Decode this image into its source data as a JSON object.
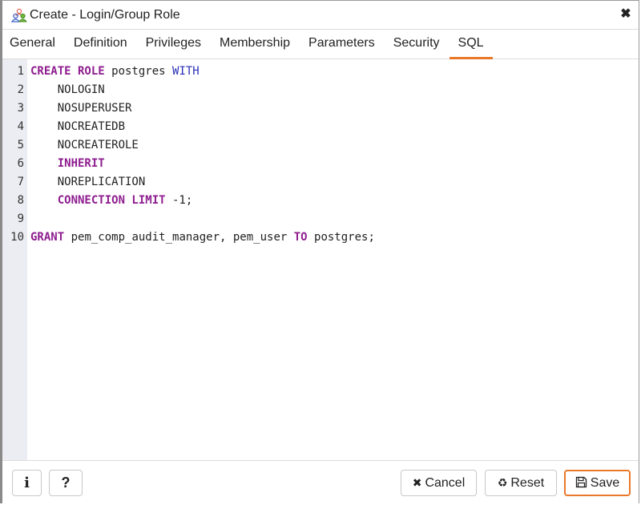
{
  "window": {
    "title": "Create - Login/Group Role",
    "icon": "group-role-icon",
    "close_icon": "✖"
  },
  "tabs": [
    {
      "label": "General",
      "active": false
    },
    {
      "label": "Definition",
      "active": false
    },
    {
      "label": "Privileges",
      "active": false
    },
    {
      "label": "Membership",
      "active": false
    },
    {
      "label": "Parameters",
      "active": false
    },
    {
      "label": "Security",
      "active": false
    },
    {
      "label": "SQL",
      "active": true
    }
  ],
  "editor": {
    "lines": [
      {
        "num": "1",
        "tokens": [
          {
            "t": "CREATE ROLE",
            "c": "kw"
          },
          {
            "t": " postgres ",
            "c": ""
          },
          {
            "t": "WITH",
            "c": "kw2"
          }
        ]
      },
      {
        "num": "2",
        "tokens": [
          {
            "t": "    NOLOGIN",
            "c": ""
          }
        ]
      },
      {
        "num": "3",
        "tokens": [
          {
            "t": "    NOSUPERUSER",
            "c": ""
          }
        ]
      },
      {
        "num": "4",
        "tokens": [
          {
            "t": "    NOCREATEDB",
            "c": ""
          }
        ]
      },
      {
        "num": "5",
        "tokens": [
          {
            "t": "    NOCREATEROLE",
            "c": ""
          }
        ]
      },
      {
        "num": "6",
        "tokens": [
          {
            "t": "    ",
            "c": ""
          },
          {
            "t": "INHERIT",
            "c": "kw"
          }
        ]
      },
      {
        "num": "7",
        "tokens": [
          {
            "t": "    NOREPLICATION",
            "c": ""
          }
        ]
      },
      {
        "num": "8",
        "tokens": [
          {
            "t": "    ",
            "c": ""
          },
          {
            "t": "CONNECTION LIMIT",
            "c": "kw"
          },
          {
            "t": " -1;",
            "c": ""
          }
        ]
      },
      {
        "num": "9",
        "tokens": []
      },
      {
        "num": "10",
        "tokens": [
          {
            "t": "GRANT",
            "c": "kw"
          },
          {
            "t": " pem_comp_audit_manager, pem_user ",
            "c": ""
          },
          {
            "t": "TO",
            "c": "kw"
          },
          {
            "t": " postgres;",
            "c": ""
          }
        ]
      }
    ]
  },
  "footer": {
    "info_label": "i",
    "help_label": "?",
    "cancel_icon": "✖",
    "cancel_label": "Cancel",
    "reset_icon": "♻",
    "reset_label": "Reset",
    "save_icon": "🖫",
    "save_label": "Save"
  },
  "colors": {
    "accent": "#e8792a",
    "keyword": "#8e1d8f",
    "keyword_alt": "#2a2fb5",
    "gutter": "#ecedf2"
  }
}
